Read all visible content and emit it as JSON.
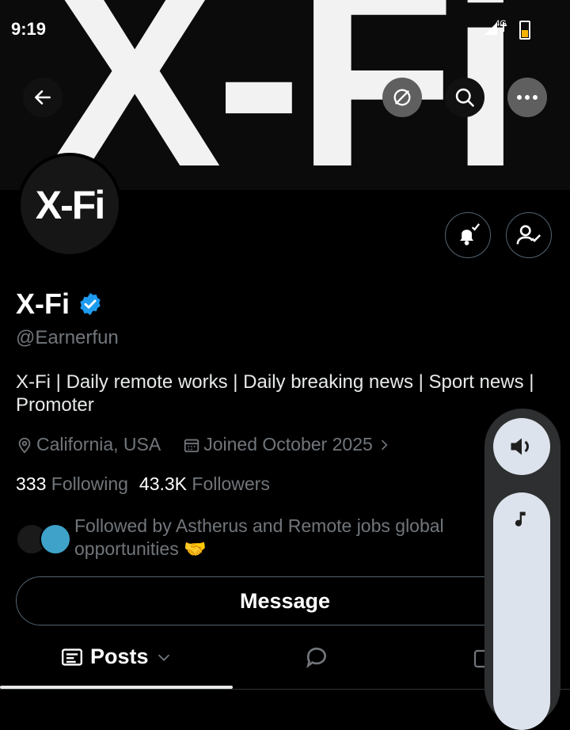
{
  "status_bar": {
    "time": "9:19",
    "network": "4G"
  },
  "banner": {
    "logo_text": "X-Fi"
  },
  "header_actions": {
    "back": "back-arrow-icon",
    "refresh": "refresh-icon",
    "search": "search-icon",
    "more": "more-horizontal-icon"
  },
  "profile": {
    "avatar_text": "X-Fi",
    "display_name": "X-Fi",
    "verified": true,
    "handle": "@Earnerfun",
    "bio": "X-Fi | Daily remote works | Daily breaking news | Sport news | Promoter",
    "location": "California, USA",
    "joined": "Joined October 2025",
    "following_count": "333",
    "following_label": "Following",
    "followers_count": "43.3K",
    "followers_label": "Followers",
    "followed_by": "Followed by Astherus and Remote jobs global opportunities 🤝"
  },
  "actions": {
    "message_label": "Message"
  },
  "tabs": [
    {
      "label": "Posts",
      "active": true
    }
  ],
  "volume_overlay": {
    "level": 0.0
  },
  "colors": {
    "background": "#000000",
    "primary_text": "#e7e9ea",
    "secondary_text": "#71767b",
    "verified_blue": "#1d9bf0",
    "border": "#536471"
  }
}
